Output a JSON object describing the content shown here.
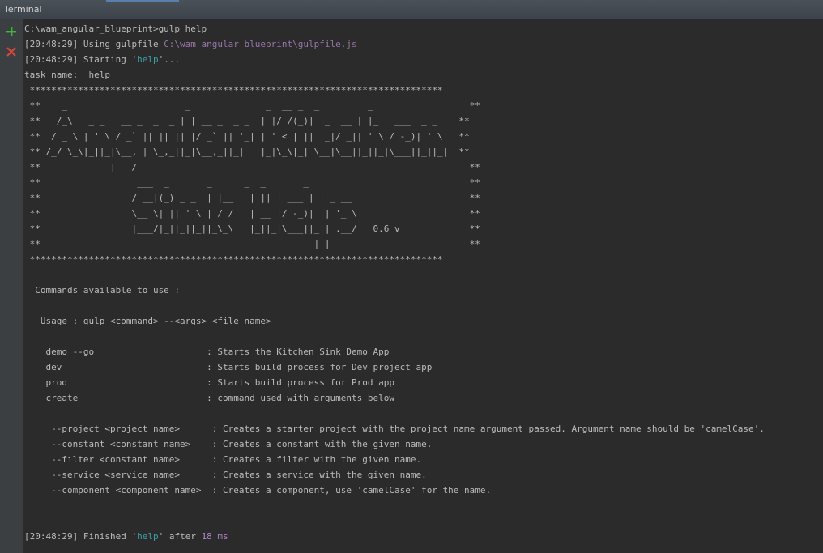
{
  "window": {
    "title": "Terminal"
  },
  "sidebar": {
    "new_session_icon": "plus-icon",
    "close_session_icon": "close-icon",
    "colors": {
      "plus": "#3fb43f",
      "close": "#d9463c"
    }
  },
  "terminal": {
    "colors": {
      "background": "#2b2b2b",
      "text": "#bbbbbb",
      "path": "#9876aa",
      "task_name": "#3e9fa8",
      "number": "#b083c9"
    },
    "prompt_line": "C:\\wam_angular_blueprint>gulp help",
    "using_prefix": "[20:48:29] Using gulpfile ",
    "using_path": "C:\\wam_angular_blueprint\\gulpfile.js",
    "starting_prefix": "[20:48:29] Starting '",
    "starting_task": "help",
    "starting_suffix": "'...",
    "task_name_line": "task name:  help",
    "banner": [
      " *****************************************************************************",
      " **    _                      _              _  __ _  _         _                  **",
      " **   /_\\   _ _   __ _  _  _ | | __ _  _ _  | |/ /(_)| |_  __ | |_   ___  _ _    **",
      " **  / _ \\ | ' \\ / _` || || || |/ _` || '_| | ' < | ||  _|/ _|| ' \\ / -_)| ' \\   **",
      " ** /_/ \\_\\|_||_|\\__, | \\_,_||_|\\__,_||_|   |_|\\_\\|_| \\__|\\__||_||_|\\___||_||_|  **",
      " **             |___/                                                              **",
      " **                  ___  _       _      _  _       _                              **",
      " **                 / __|(_) _ _  | |__   | || | ___ | | _ __                      **",
      " **                 \\__ \\| || ' \\ | / /   | __ |/ -_)| || '_ \\                     **",
      " **                 |___/|_||_||_||_\\_\\   |_||_|\\___||_|| .__/   0.6 v             **",
      " **                                                   |_|                          **",
      " *****************************************************************************"
    ],
    "commands_heading": "  Commands available to use :",
    "usage_line": "   Usage : gulp <command> --<args> <file name>",
    "commands": [
      "    demo --go                     : Starts the Kitchen Sink Demo App",
      "    dev                           : Starts build process for Dev project app",
      "    prod                          : Starts build process for Prod app",
      "    create                        : command used with arguments below"
    ],
    "arguments": [
      "     --project <project name>      : Creates a starter project with the project name argument passed. Argument name should be 'camelCase'.",
      "     --constant <constant name>    : Creates a constant with the given name.",
      "     --filter <constant name>      : Creates a filter with the given name.",
      "     --service <service name>      : Creates a service with the given name.",
      "     --component <component name>  : Creates a component, use 'camelCase' for the name."
    ],
    "finished_prefix": "[20:48:29] Finished '",
    "finished_task": "help",
    "finished_middle": "' after ",
    "finished_time": "18 ms"
  }
}
